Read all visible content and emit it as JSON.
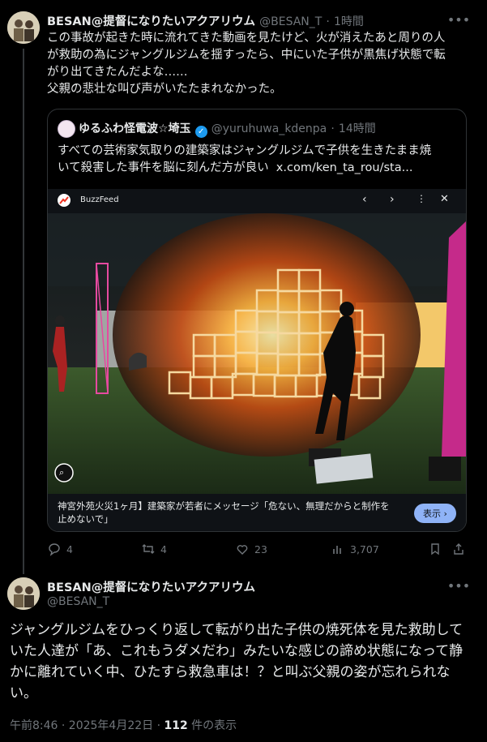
{
  "tweet1": {
    "display_name": "BESAN@提督になりたいアクアリウム",
    "handle": "@BESAN_T",
    "time": "1時間",
    "lines": [
      "この事故が起きた時に流れてきた動画を見たけど、火が消えたあと周りの人",
      "が救助の為にジャングルジムを揺すったら、中にいた子供が黒焦げ状態で転",
      "がり出てきたんだよな‥‥‥",
      "父親の悲壮な叫び声がいたたまれなかった。"
    ],
    "quote": {
      "display_name": "ゆるふわ怪電波☆埼玉",
      "handle": "@yuruhuwa_kdenpa",
      "time": "14時間",
      "lines": [
        "すべての芸術家気取りの建築家はジャングルジムで子供を生きたまま焼",
        "いて殺害した事件を脳に刻んだ方が良い"
      ],
      "link": "x.com/ken_ta_rou/sta...",
      "card": {
        "source": "BuzzFeed",
        "caption_line1": "神宮外苑火災1ヶ月】建築家が若者にメッセージ「危ない、無理だからと制作を",
        "caption_line2": "止めないで」",
        "button": "表示"
      }
    },
    "actions": {
      "replies": "4",
      "reposts": "4",
      "likes": "23",
      "views": "3,707"
    }
  },
  "tweet2": {
    "display_name": "BESAN@提督になりたいアクアリウム",
    "handle": "@BESAN_T",
    "lines": [
      "ジャングルジムをひっくり返して転がり出た子供の焼死体を見た救助して",
      "いた人達が「あ、これもうダメだわ」みたいな感じの諦め状態になって静",
      "かに離れていく中、ひたすら救急車は！？と叫ぶ父親の姿が忘れられな",
      "い。"
    ],
    "timestamp": "午前8:46 · 2025年4月22日 · ",
    "views_count": "112",
    "views_label": " 件の表示"
  },
  "icons": [
    "more-icon",
    "verified-icon",
    "chevron-left-icon",
    "chevron-right-icon",
    "close-icon",
    "reply-icon",
    "repost-icon",
    "like-icon",
    "views-icon",
    "bookmark-icon",
    "share-icon",
    "image-search-icon"
  ],
  "colors": {
    "background": "#000000",
    "text": "#e7e9ea",
    "muted": "#71767b",
    "verified": "#1d9bf0",
    "show_button": "#8fb3f7"
  }
}
